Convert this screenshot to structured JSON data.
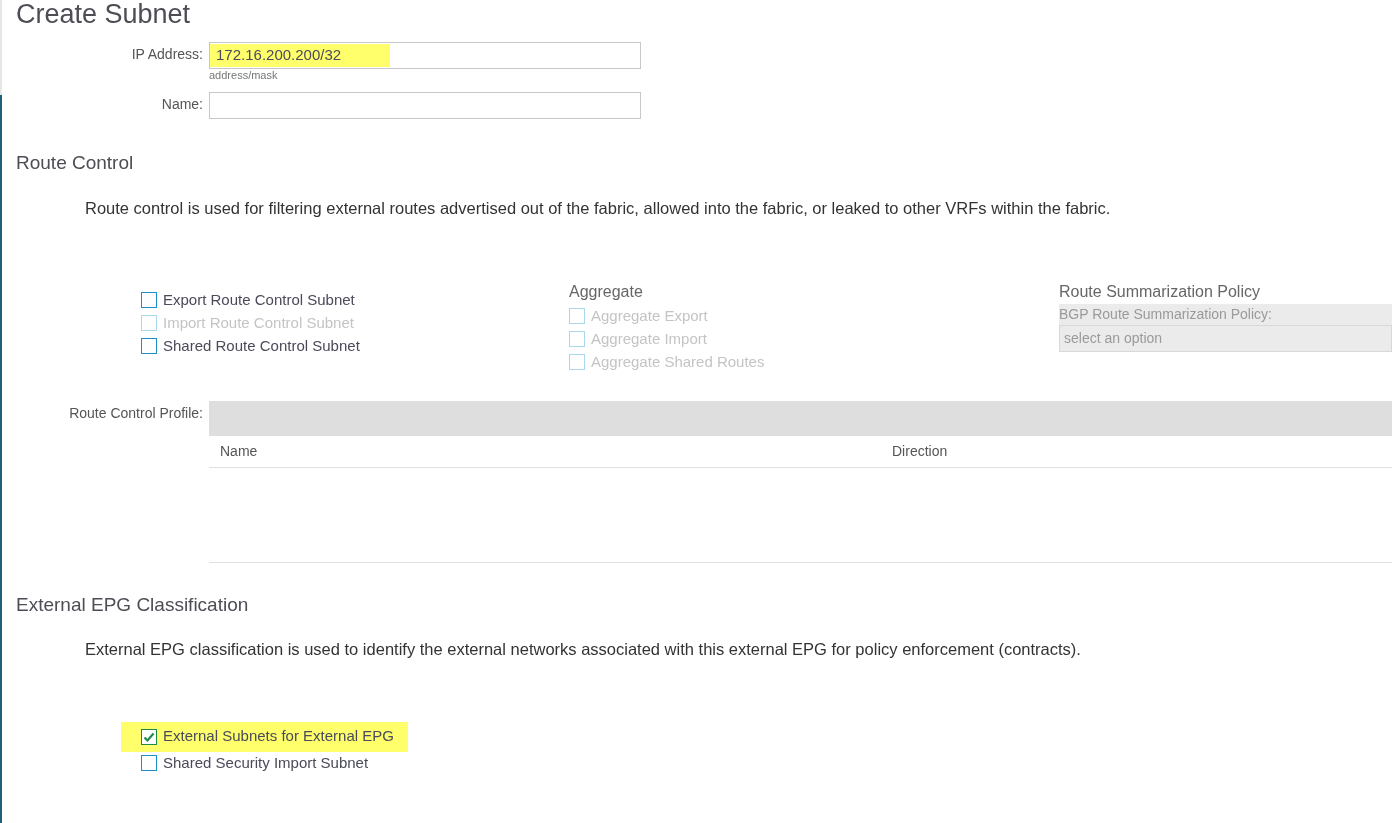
{
  "title": "Create Subnet",
  "fields": [
    {
      "label": "IP Address:",
      "value": "172.16.200.200/32",
      "hint": "address/mask",
      "highlighted": true
    },
    {
      "label": "Name:"
    }
  ],
  "route_control": {
    "heading": "Route Control",
    "description": "Route control is used for filtering external routes advertised out of the fabric, allowed into the fabric, or leaked to other VRFs within the fabric.",
    "options": [
      {
        "label": "Export Route Control Subnet",
        "checked": false,
        "disabled": false
      },
      {
        "label": "Import Route Control Subnet",
        "checked": false,
        "disabled": true
      },
      {
        "label": "Shared Route Control Subnet",
        "checked": false,
        "disabled": false
      }
    ],
    "aggregate": {
      "heading": "Aggregate",
      "options": [
        {
          "label": "Aggregate Export",
          "checked": false,
          "disabled": true
        },
        {
          "label": "Aggregate Import",
          "checked": false,
          "disabled": true
        },
        {
          "label": "Aggregate Shared Routes",
          "checked": false,
          "disabled": true
        }
      ]
    },
    "summarization": {
      "heading": "Route Summarization Policy",
      "label": "BGP Route Summarization Policy:",
      "placeholder": "select an option",
      "disabled": true
    },
    "profile": {
      "label": "Route Control Profile:",
      "columns": [
        "Name",
        "Direction"
      ]
    }
  },
  "classification": {
    "heading": "External EPG Classification",
    "description": "External EPG classification is used to identify the external networks associated with this external EPG for policy enforcement (contracts).",
    "options": [
      {
        "label": "External Subnets for External EPG",
        "checked": true,
        "disabled": false,
        "highlighted": true
      },
      {
        "label": "Shared Security Import Subnet",
        "checked": false,
        "disabled": false,
        "highlighted": false
      }
    ]
  }
}
